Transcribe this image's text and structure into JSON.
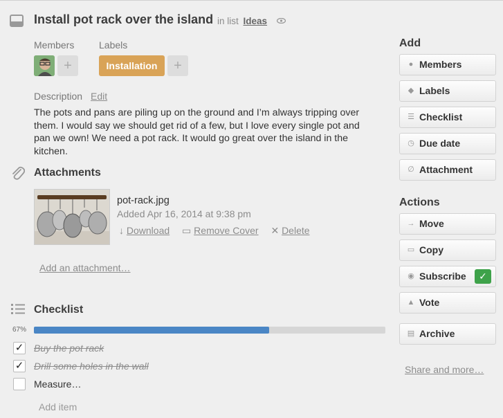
{
  "card": {
    "title": "Install pot rack over the island",
    "in_list_prefix": "in list",
    "list_name": "Ideas"
  },
  "members": {
    "heading": "Members",
    "add": "+"
  },
  "labels": {
    "heading": "Labels",
    "items": [
      "Installation"
    ],
    "add": "+",
    "color": "#d9a357"
  },
  "description": {
    "heading": "Description",
    "edit": "Edit",
    "text": "The pots and pans are piling up on the ground and I’m always tripping over them. I would say we should get rid of a few, but I love every single pot and pan we own! We need a pot rack. It would go great over the island in the kitchen."
  },
  "attachments": {
    "heading": "Attachments",
    "file_name": "pot-rack.jpg",
    "added": "Added Apr 16, 2014 at 9:38 pm",
    "download": "Download",
    "remove_cover": "Remove Cover",
    "delete": "Delete",
    "add_link": "Add an attachment…"
  },
  "checklist": {
    "heading": "Checklist",
    "percent_label": "67%",
    "progress": 0.67,
    "items": [
      {
        "text": "Buy the pot rack",
        "checked": true
      },
      {
        "text": "Drill some holes in the wall",
        "checked": true
      },
      {
        "text": "Measure…",
        "checked": false
      }
    ],
    "add_item": "Add item"
  },
  "sidebar": {
    "add_heading": "Add",
    "add_buttons": [
      "Members",
      "Labels",
      "Checklist",
      "Due date",
      "Attachment"
    ],
    "actions_heading": "Actions",
    "action_buttons": [
      "Move",
      "Copy",
      "Subscribe",
      "Vote",
      "Archive"
    ],
    "share": "Share and more…"
  },
  "colors": {
    "progress": "#4a86c5",
    "subscribe_check": "#3ea24a",
    "label": "#d9a357"
  }
}
